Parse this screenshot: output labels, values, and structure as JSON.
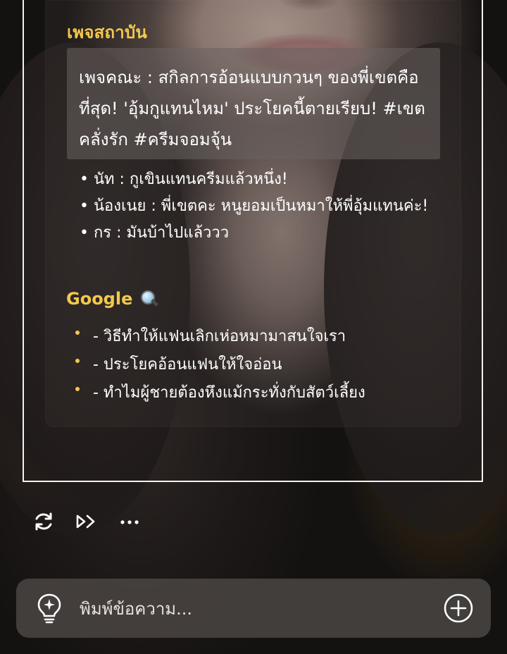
{
  "page_label": "เพจสถาบัน",
  "post_text": "เพจคณะ : สกิลการอ้อนแบบกวนๆ ของพี่เขตคือที่สุด! 'อุ้มกูแทนไหม' ประโยคนี้ตายเรียบ! #เขตคลั่งรัก #ครีมจอมจุ้น",
  "comments": [
    "• นัท : กูเขินแทนครีมแล้วหนึ่ง!",
    "• น้องเนย : พี่เขตคะ หนูยอมเป็นหมาให้พี่อุ้มแทนค่ะ!",
    "• กร : มันบ้าไปแล้ววว"
  ],
  "google": {
    "title": "Google",
    "icon": "magnifying-glass-icon",
    "items": [
      "- วิธีทำให้แฟนเลิกเห่อหมามาสนใจเรา",
      "- ประโยคอ้อนแฟนให้ใจอ่อน",
      "- ทำไมผู้ชายต้องหึงแม้กระทั่งกับสัตว์เลี้ยง"
    ]
  },
  "actions": {
    "regenerate_icon": "regenerate-icon",
    "continue_icon": "fast-forward-icon",
    "more_icon": "more-dots-icon"
  },
  "composer": {
    "placeholder": "พิมพ์ข้อความ...",
    "left_icon": "lightbulb-icon",
    "right_icon": "plus-circle-icon"
  },
  "colors": {
    "accent": "#f2c94c",
    "text": "#ffffff",
    "frame": "#f2f2f2"
  }
}
